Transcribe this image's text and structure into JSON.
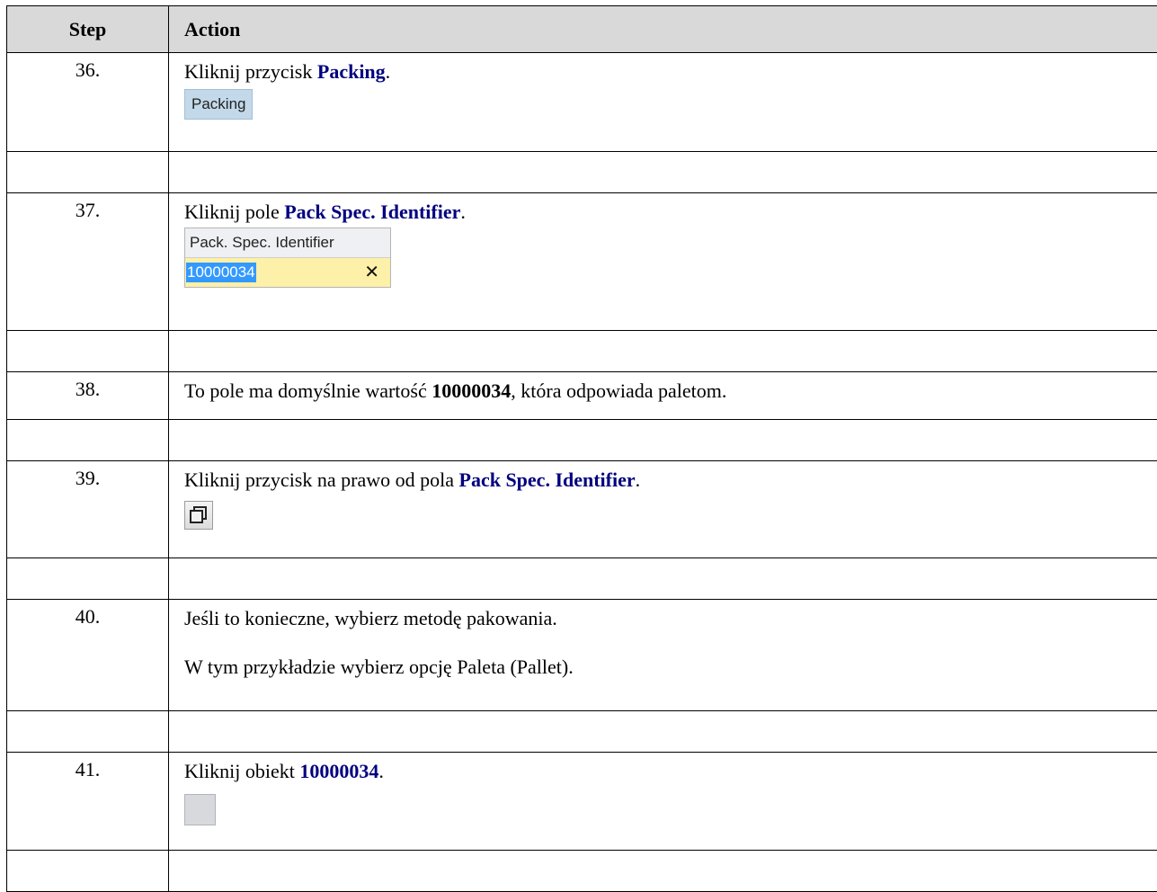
{
  "header": {
    "step": "Step",
    "action": "Action"
  },
  "steps": {
    "s36": {
      "num": "36.",
      "pre": "Kliknij przycisk ",
      "bold": "Packing",
      "post": ".",
      "button_label": "Packing"
    },
    "s37": {
      "num": "37.",
      "pre": "Kliknij pole ",
      "bold": "Pack Spec. Identifier",
      "post": ".",
      "field_label": "Pack. Spec. Identifier",
      "field_value": "10000034",
      "clear_glyph": "✕"
    },
    "s38": {
      "num": "38.",
      "pre": "To pole ma domyślnie wartość ",
      "bold": "10000034",
      "post": ", która odpowiada paletom."
    },
    "s39": {
      "num": "39.",
      "pre": "Kliknij przycisk na prawo od pola ",
      "bold": "Pack Spec. Identifier",
      "post": ".",
      "icon": "window-restore-icon"
    },
    "s40": {
      "num": "40.",
      "line1": "Jeśli to konieczne, wybierz metodę pakowania.",
      "line2": "W tym przykładzie wybierz opcję Paleta (Pallet)."
    },
    "s41": {
      "num": "41.",
      "pre": "Kliknij obiekt ",
      "bold": "10000034",
      "post": "."
    }
  },
  "colors": {
    "header_bg": "#d9d9d9",
    "bold_blue": "#00007f",
    "button_bg": "#c3d9ea",
    "field_bg": "#fdf0a8",
    "selection": "#3399ff"
  }
}
